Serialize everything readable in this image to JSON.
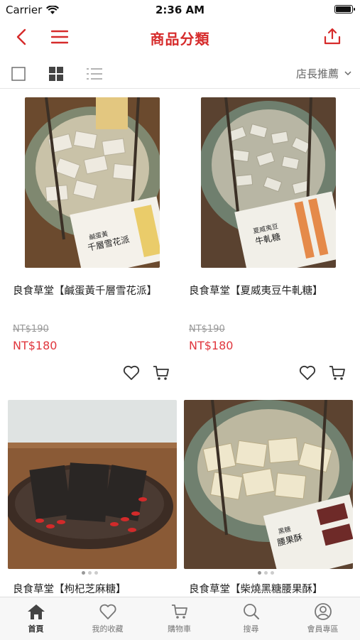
{
  "status_bar": {
    "carrier": "Carrier",
    "time": "2:36 AM",
    "battery_level": 1.0
  },
  "nav": {
    "title": "商品分類"
  },
  "toolbar": {
    "sort_label": "店長推薦"
  },
  "products": [
    {
      "name": "良食草堂【鹹蛋黃千層雪花派】",
      "old_price": "NT$190",
      "price": "NT$180",
      "image_pack_text": "千層雪花派",
      "image_pack_sub": "鹹蛋黃"
    },
    {
      "name": "良食草堂【夏威夷豆牛軋糖】",
      "old_price": "NT$190",
      "price": "NT$180",
      "image_pack_text": "牛軋糖",
      "image_pack_sub": "夏威夷豆"
    },
    {
      "name": "良食草堂【枸杞芝麻糖】",
      "old_price": "",
      "price": "",
      "image_pack_text": "",
      "image_pack_sub": ""
    },
    {
      "name": "良食草堂【柴燒黑糖腰果酥】",
      "old_price": "",
      "price": "",
      "image_pack_text": "腰果酥",
      "image_pack_sub": "黑糖"
    }
  ],
  "tabs": [
    {
      "label": "首頁",
      "icon": "home-icon",
      "active": true
    },
    {
      "label": "我的收藏",
      "icon": "heart-icon",
      "active": false
    },
    {
      "label": "購物車",
      "icon": "cart-icon",
      "active": false
    },
    {
      "label": "搜尋",
      "icon": "search-icon",
      "active": false
    },
    {
      "label": "會員專區",
      "icon": "user-icon",
      "active": false
    }
  ],
  "colors": {
    "accent": "#d62b2b",
    "price": "#e0363d",
    "tab_bg": "#f7f7f7"
  }
}
